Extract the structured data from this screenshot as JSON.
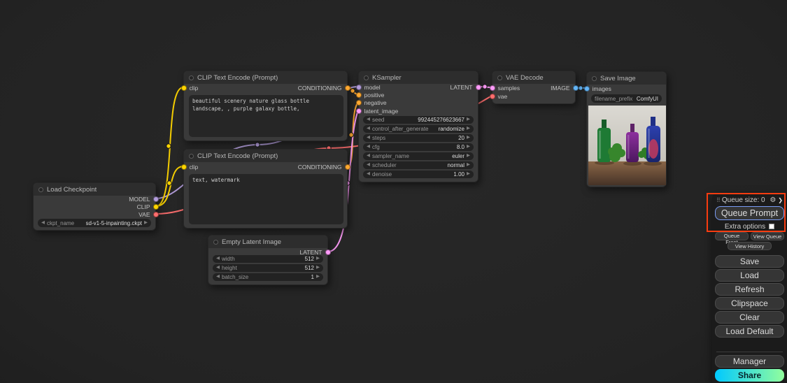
{
  "icons": {
    "drag": "⠿",
    "gear": "⚙",
    "chevron_right": "❯",
    "arrow_left": "◀",
    "arrow_right": "▶"
  },
  "colors": {
    "model": "#B39DDB",
    "clip": "#FFD500",
    "vae": "#FF6E6E",
    "conditioning": "#FFA931",
    "latent": "#FF9CF9",
    "image": "#64B5F6",
    "annotation": "#F83C10",
    "share_gradient_start": "#00C9FF",
    "share_gradient_end": "#92FE9D",
    "queue_prompt_border": "#7A9CF5"
  },
  "nodes": {
    "load_checkpoint": {
      "title": "Load Checkpoint",
      "outputs": [
        "MODEL",
        "CLIP",
        "VAE"
      ],
      "widgets": [
        {
          "label": "ckpt_name",
          "value": "sd-v1-5-inpainting.ckpt"
        }
      ]
    },
    "clip_text_encode_positive": {
      "title": "CLIP Text Encode (Prompt)",
      "inputs": [
        "clip"
      ],
      "outputs": [
        "CONDITIONING"
      ],
      "text": "beautiful scenery nature glass bottle landscape, , purple galaxy bottle,"
    },
    "clip_text_encode_negative": {
      "title": "CLIP Text Encode (Prompt)",
      "inputs": [
        "clip"
      ],
      "outputs": [
        "CONDITIONING"
      ],
      "text": "text, watermark"
    },
    "ksampler": {
      "title": "KSampler",
      "inputs": [
        "model",
        "positive",
        "negative",
        "latent_image"
      ],
      "outputs": [
        "LATENT"
      ],
      "widgets": [
        {
          "label": "seed",
          "value": "992445276623667"
        },
        {
          "label": "control_after_generate",
          "value": "randomize"
        },
        {
          "label": "steps",
          "value": "20"
        },
        {
          "label": "cfg",
          "value": "8.0"
        },
        {
          "label": "sampler_name",
          "value": "euler"
        },
        {
          "label": "scheduler",
          "value": "normal"
        },
        {
          "label": "denoise",
          "value": "1.00"
        }
      ]
    },
    "vae_decode": {
      "title": "VAE Decode",
      "inputs": [
        "samples",
        "vae"
      ],
      "outputs": [
        "IMAGE"
      ]
    },
    "save_image": {
      "title": "Save Image",
      "inputs": [
        "images"
      ],
      "widgets": [
        {
          "label": "filename_prefix",
          "value": "ComfyUI"
        }
      ]
    },
    "empty_latent_image": {
      "title": "Empty Latent Image",
      "outputs": [
        "LATENT"
      ],
      "widgets": [
        {
          "label": "width",
          "value": "512"
        },
        {
          "label": "height",
          "value": "512"
        },
        {
          "label": "batch_size",
          "value": "1"
        }
      ]
    }
  },
  "menu": {
    "queue_size": "Queue size: 0",
    "queue_prompt": "Queue Prompt",
    "extra_options": "Extra options",
    "queue_front": "Queue Front",
    "view_queue": "View Queue",
    "view_history": "View History",
    "save": "Save",
    "load": "Load",
    "refresh": "Refresh",
    "clipspace": "Clipspace",
    "clear": "Clear",
    "load_default": "Load Default",
    "manager": "Manager",
    "share": "Share"
  }
}
